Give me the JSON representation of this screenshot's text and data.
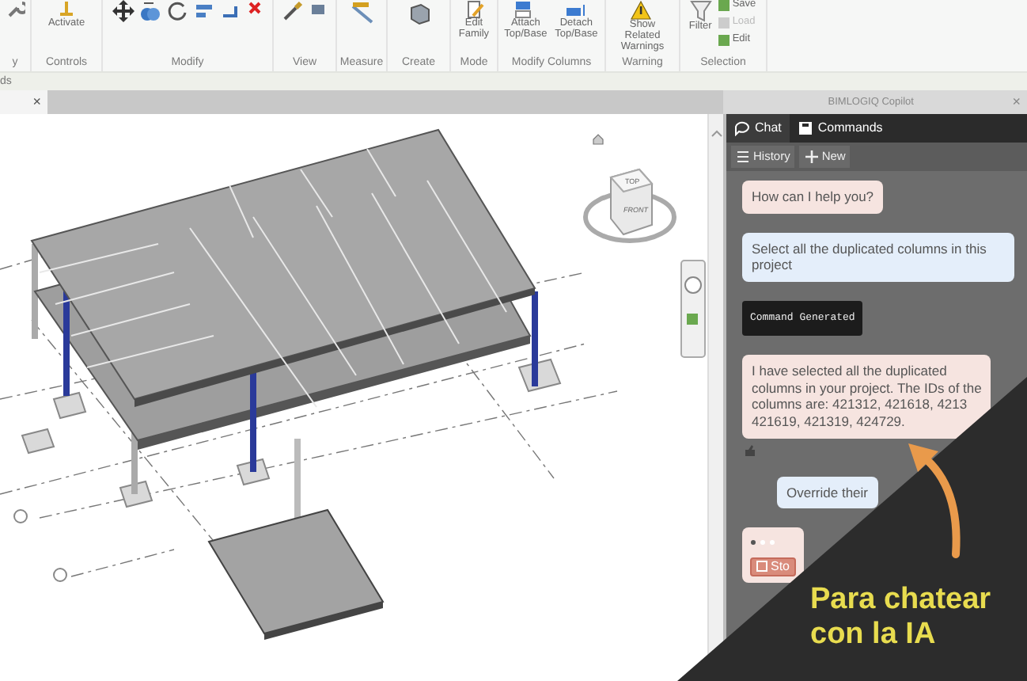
{
  "ribbon": {
    "panels": [
      {
        "label": "y"
      },
      {
        "label": "Controls",
        "buttons": [
          {
            "label": "Activate"
          }
        ]
      },
      {
        "label": "Modify"
      },
      {
        "label": "View"
      },
      {
        "label": "Measure"
      },
      {
        "label": "Create"
      },
      {
        "label": "Mode",
        "buttons": [
          {
            "label": "Edit Family"
          }
        ]
      },
      {
        "label": "Modify Columns",
        "buttons": [
          {
            "label": "Attach Top/Base"
          },
          {
            "label": "Detach Top/Base"
          }
        ]
      },
      {
        "label": "Warning",
        "buttons": [
          {
            "label": "Show Related Warnings"
          }
        ]
      },
      {
        "label": "Selection",
        "buttons": [
          {
            "label": "Filter"
          }
        ],
        "small_buttons": [
          {
            "label": "Save",
            "disabled": false
          },
          {
            "label": "Load",
            "disabled": true
          },
          {
            "label": "Edit",
            "disabled": false
          }
        ]
      }
    ]
  },
  "context_bar": {
    "text": "ds"
  },
  "view_tab": {
    "close": "×"
  },
  "viewcube": {
    "top": "TOP",
    "front": "FRONT"
  },
  "copilot": {
    "title": "BIMLOGIQ Copilot",
    "close": "×",
    "tabs": [
      {
        "label": "Chat",
        "selected": true
      },
      {
        "label": "Commands",
        "selected": false
      }
    ],
    "toolbar": [
      {
        "label": "History"
      },
      {
        "label": "New"
      }
    ],
    "messages": [
      {
        "kind": "assistant",
        "lines": [
          "How can I help you?"
        ]
      },
      {
        "kind": "user",
        "lines": [
          "Select all the duplicated columns in this",
          "project"
        ]
      },
      {
        "kind": "command",
        "lines": [
          "Command Generated"
        ]
      },
      {
        "kind": "assistant",
        "lines": [
          "I have selected all the duplicated",
          "columns in your project. The IDs of the",
          "columns are: 421312, 421618, 4213",
          "421619, 421319, 424729."
        ]
      },
      {
        "kind": "user",
        "lines": [
          "Override their"
        ]
      },
      {
        "kind": "loading",
        "stop": "Sto"
      }
    ]
  },
  "overlay": {
    "text": "Para chatear con la IA"
  }
}
